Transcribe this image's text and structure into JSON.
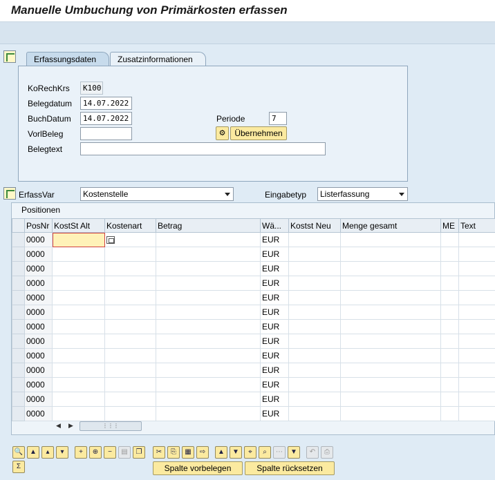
{
  "window": {
    "title": "Manuelle Umbuchung von Primärkosten erfassen"
  },
  "tabs": [
    {
      "label": "Erfassungsdaten",
      "active": true
    },
    {
      "label": "Zusatzinformationen",
      "active": false
    }
  ],
  "form": {
    "korechkrs": {
      "label": "KoRechKrs",
      "value": "K100"
    },
    "belegdatum": {
      "label": "Belegdatum",
      "value": "14.07.2022"
    },
    "buchdatum": {
      "label": "BuchDatum",
      "value": "14.07.2022"
    },
    "vorlbeleg": {
      "label": "VorlBeleg",
      "value": ""
    },
    "belegtext": {
      "label": "Belegtext",
      "value": ""
    },
    "periode": {
      "label": "Periode",
      "value": "7"
    },
    "uebernehmen_label": "Übernehmen"
  },
  "erfassvar": {
    "label": "ErfassVar",
    "value": "Kostenstelle"
  },
  "eingabetyp": {
    "label": "Eingabetyp",
    "value": "Listerfassung"
  },
  "grid": {
    "caption": "Positionen",
    "columns": [
      "PosNr",
      "KostSt Alt",
      "Kostenart",
      "Betrag",
      "Wä...",
      "Kostst Neu",
      "Menge gesamt",
      "ME",
      "Text"
    ],
    "rows": [
      {
        "posnr": "0000",
        "currency": "EUR"
      },
      {
        "posnr": "0000",
        "currency": "EUR"
      },
      {
        "posnr": "0000",
        "currency": "EUR"
      },
      {
        "posnr": "0000",
        "currency": "EUR"
      },
      {
        "posnr": "0000",
        "currency": "EUR"
      },
      {
        "posnr": "0000",
        "currency": "EUR"
      },
      {
        "posnr": "0000",
        "currency": "EUR"
      },
      {
        "posnr": "0000",
        "currency": "EUR"
      },
      {
        "posnr": "0000",
        "currency": "EUR"
      },
      {
        "posnr": "0000",
        "currency": "EUR"
      },
      {
        "posnr": "0000",
        "currency": "EUR"
      },
      {
        "posnr": "0000",
        "currency": "EUR"
      },
      {
        "posnr": "0000",
        "currency": "EUR"
      }
    ]
  },
  "bottom": {
    "spalte_vorbelegen": "Spalte vorbelegen",
    "spalte_ruecksetzen": "Spalte rücksetzen"
  },
  "colors": {
    "background": "#dfebf5",
    "button": "#fbeaa0",
    "focus_cell": "#fff2b8"
  }
}
